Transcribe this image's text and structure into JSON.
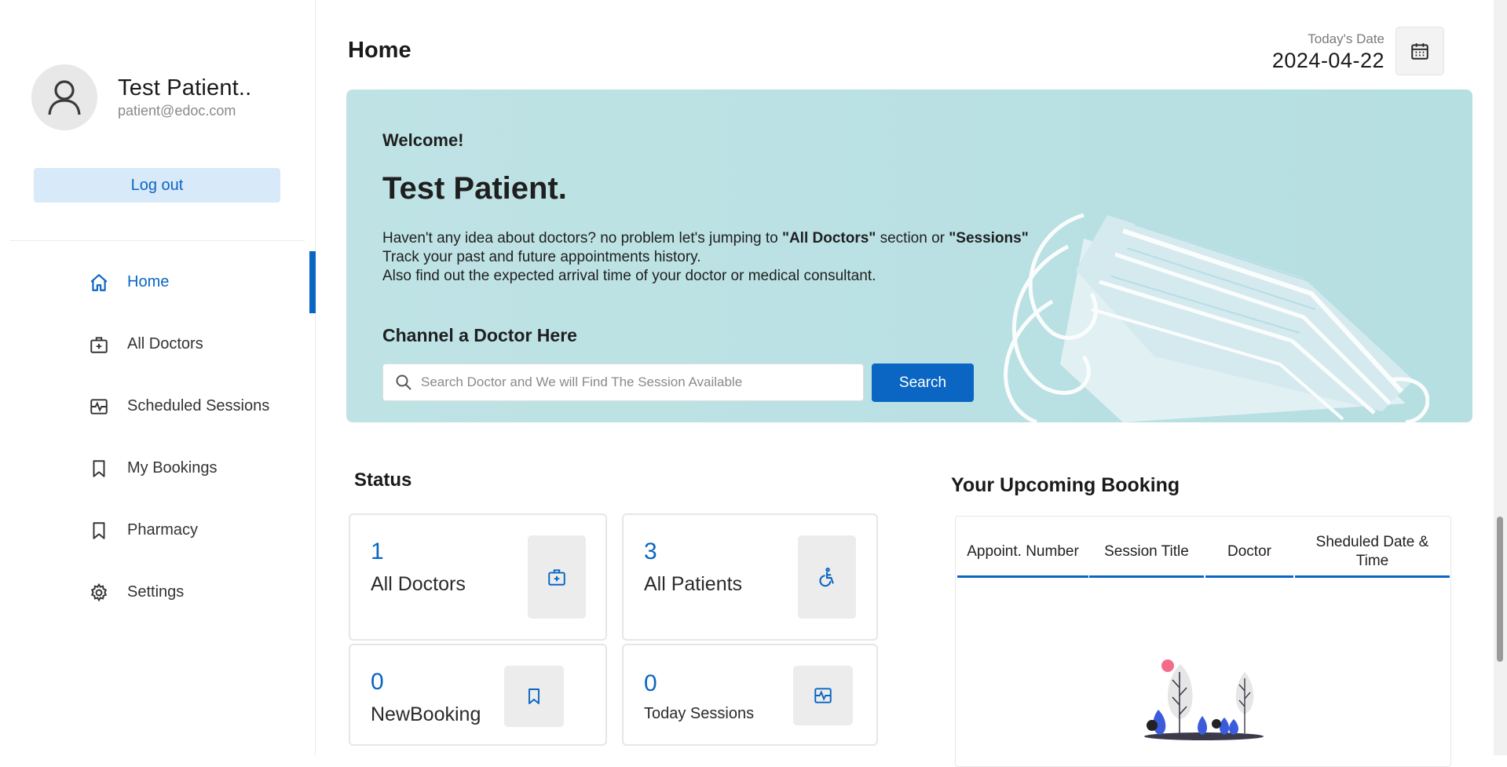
{
  "profile": {
    "name": "Test Patient..",
    "email": "patient@edoc.com",
    "icon": "user-icon"
  },
  "logout_label": "Log out",
  "nav": [
    {
      "label": "Home",
      "icon": "home-icon",
      "active": true
    },
    {
      "label": "All Doctors",
      "icon": "medical-bag-icon"
    },
    {
      "label": "Scheduled Sessions",
      "icon": "pulse-icon"
    },
    {
      "label": "My Bookings",
      "icon": "bookmark-icon"
    },
    {
      "label": "Pharmacy",
      "icon": "bookmark-icon"
    },
    {
      "label": "Settings",
      "icon": "gear-icon"
    }
  ],
  "header": {
    "title": "Home",
    "date_label": "Today's Date",
    "date_value": "2024-04-22",
    "calendar_icon": "calendar-icon"
  },
  "banner": {
    "welcome": "Welcome!",
    "name": "Test Patient.",
    "line1_pre": "Haven't any idea about doctors? no problem let's jumping to ",
    "line1_bold1": "\"All Doctors\"",
    "line1_mid": " section or ",
    "line1_bold2": "\"Sessions\"",
    "line2": "Track your past and future appointments history.",
    "line3": "Also find out the expected arrival time of your doctor or medical consultant.",
    "channel_title": "Channel a Doctor Here",
    "search_placeholder": "Search Doctor and We will Find The Session Available",
    "search_button": "Search"
  },
  "status": {
    "title": "Status",
    "cards": [
      {
        "value": "1",
        "label": "All Doctors",
        "icon": "medical-bag-icon"
      },
      {
        "value": "3",
        "label": "All Patients",
        "icon": "wheelchair-icon"
      },
      {
        "value": "0",
        "label": "NewBooking",
        "icon": "bookmark-icon"
      },
      {
        "value": "0",
        "label": "Today Sessions",
        "icon": "pulse-icon"
      }
    ]
  },
  "upcoming": {
    "title": "Your Upcoming Booking",
    "columns": [
      "Appoint. Number",
      "Session Title",
      "Doctor",
      "Sheduled Date & Time"
    ]
  },
  "colors": {
    "accent": "#0a66c2",
    "banner_bg": "#bfe3e5",
    "button_light": "#d8e9fa"
  }
}
